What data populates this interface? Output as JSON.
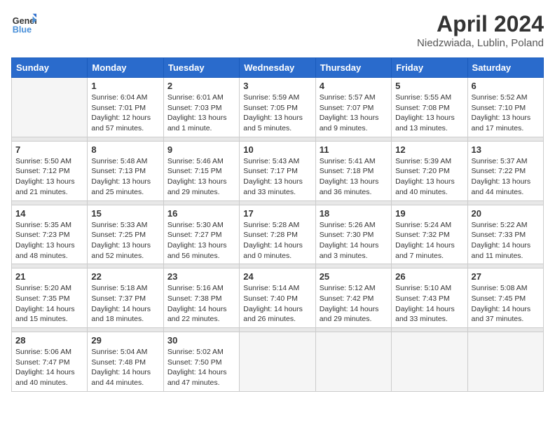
{
  "logo": {
    "line1": "General",
    "line2": "Blue"
  },
  "title": "April 2024",
  "subtitle": "Niedzwiada, Lublin, Poland",
  "days_header": [
    "Sunday",
    "Monday",
    "Tuesday",
    "Wednesday",
    "Thursday",
    "Friday",
    "Saturday"
  ],
  "weeks": [
    [
      {
        "day": "",
        "sunrise": "",
        "sunset": "",
        "daylight": ""
      },
      {
        "day": "1",
        "sunrise": "Sunrise: 6:04 AM",
        "sunset": "Sunset: 7:01 PM",
        "daylight": "Daylight: 12 hours and 57 minutes."
      },
      {
        "day": "2",
        "sunrise": "Sunrise: 6:01 AM",
        "sunset": "Sunset: 7:03 PM",
        "daylight": "Daylight: 13 hours and 1 minute."
      },
      {
        "day": "3",
        "sunrise": "Sunrise: 5:59 AM",
        "sunset": "Sunset: 7:05 PM",
        "daylight": "Daylight: 13 hours and 5 minutes."
      },
      {
        "day": "4",
        "sunrise": "Sunrise: 5:57 AM",
        "sunset": "Sunset: 7:07 PM",
        "daylight": "Daylight: 13 hours and 9 minutes."
      },
      {
        "day": "5",
        "sunrise": "Sunrise: 5:55 AM",
        "sunset": "Sunset: 7:08 PM",
        "daylight": "Daylight: 13 hours and 13 minutes."
      },
      {
        "day": "6",
        "sunrise": "Sunrise: 5:52 AM",
        "sunset": "Sunset: 7:10 PM",
        "daylight": "Daylight: 13 hours and 17 minutes."
      }
    ],
    [
      {
        "day": "7",
        "sunrise": "Sunrise: 5:50 AM",
        "sunset": "Sunset: 7:12 PM",
        "daylight": "Daylight: 13 hours and 21 minutes."
      },
      {
        "day": "8",
        "sunrise": "Sunrise: 5:48 AM",
        "sunset": "Sunset: 7:13 PM",
        "daylight": "Daylight: 13 hours and 25 minutes."
      },
      {
        "day": "9",
        "sunrise": "Sunrise: 5:46 AM",
        "sunset": "Sunset: 7:15 PM",
        "daylight": "Daylight: 13 hours and 29 minutes."
      },
      {
        "day": "10",
        "sunrise": "Sunrise: 5:43 AM",
        "sunset": "Sunset: 7:17 PM",
        "daylight": "Daylight: 13 hours and 33 minutes."
      },
      {
        "day": "11",
        "sunrise": "Sunrise: 5:41 AM",
        "sunset": "Sunset: 7:18 PM",
        "daylight": "Daylight: 13 hours and 36 minutes."
      },
      {
        "day": "12",
        "sunrise": "Sunrise: 5:39 AM",
        "sunset": "Sunset: 7:20 PM",
        "daylight": "Daylight: 13 hours and 40 minutes."
      },
      {
        "day": "13",
        "sunrise": "Sunrise: 5:37 AM",
        "sunset": "Sunset: 7:22 PM",
        "daylight": "Daylight: 13 hours and 44 minutes."
      }
    ],
    [
      {
        "day": "14",
        "sunrise": "Sunrise: 5:35 AM",
        "sunset": "Sunset: 7:23 PM",
        "daylight": "Daylight: 13 hours and 48 minutes."
      },
      {
        "day": "15",
        "sunrise": "Sunrise: 5:33 AM",
        "sunset": "Sunset: 7:25 PM",
        "daylight": "Daylight: 13 hours and 52 minutes."
      },
      {
        "day": "16",
        "sunrise": "Sunrise: 5:30 AM",
        "sunset": "Sunset: 7:27 PM",
        "daylight": "Daylight: 13 hours and 56 minutes."
      },
      {
        "day": "17",
        "sunrise": "Sunrise: 5:28 AM",
        "sunset": "Sunset: 7:28 PM",
        "daylight": "Daylight: 14 hours and 0 minutes."
      },
      {
        "day": "18",
        "sunrise": "Sunrise: 5:26 AM",
        "sunset": "Sunset: 7:30 PM",
        "daylight": "Daylight: 14 hours and 3 minutes."
      },
      {
        "day": "19",
        "sunrise": "Sunrise: 5:24 AM",
        "sunset": "Sunset: 7:32 PM",
        "daylight": "Daylight: 14 hours and 7 minutes."
      },
      {
        "day": "20",
        "sunrise": "Sunrise: 5:22 AM",
        "sunset": "Sunset: 7:33 PM",
        "daylight": "Daylight: 14 hours and 11 minutes."
      }
    ],
    [
      {
        "day": "21",
        "sunrise": "Sunrise: 5:20 AM",
        "sunset": "Sunset: 7:35 PM",
        "daylight": "Daylight: 14 hours and 15 minutes."
      },
      {
        "day": "22",
        "sunrise": "Sunrise: 5:18 AM",
        "sunset": "Sunset: 7:37 PM",
        "daylight": "Daylight: 14 hours and 18 minutes."
      },
      {
        "day": "23",
        "sunrise": "Sunrise: 5:16 AM",
        "sunset": "Sunset: 7:38 PM",
        "daylight": "Daylight: 14 hours and 22 minutes."
      },
      {
        "day": "24",
        "sunrise": "Sunrise: 5:14 AM",
        "sunset": "Sunset: 7:40 PM",
        "daylight": "Daylight: 14 hours and 26 minutes."
      },
      {
        "day": "25",
        "sunrise": "Sunrise: 5:12 AM",
        "sunset": "Sunset: 7:42 PM",
        "daylight": "Daylight: 14 hours and 29 minutes."
      },
      {
        "day": "26",
        "sunrise": "Sunrise: 5:10 AM",
        "sunset": "Sunset: 7:43 PM",
        "daylight": "Daylight: 14 hours and 33 minutes."
      },
      {
        "day": "27",
        "sunrise": "Sunrise: 5:08 AM",
        "sunset": "Sunset: 7:45 PM",
        "daylight": "Daylight: 14 hours and 37 minutes."
      }
    ],
    [
      {
        "day": "28",
        "sunrise": "Sunrise: 5:06 AM",
        "sunset": "Sunset: 7:47 PM",
        "daylight": "Daylight: 14 hours and 40 minutes."
      },
      {
        "day": "29",
        "sunrise": "Sunrise: 5:04 AM",
        "sunset": "Sunset: 7:48 PM",
        "daylight": "Daylight: 14 hours and 44 minutes."
      },
      {
        "day": "30",
        "sunrise": "Sunrise: 5:02 AM",
        "sunset": "Sunset: 7:50 PM",
        "daylight": "Daylight: 14 hours and 47 minutes."
      },
      {
        "day": "",
        "sunrise": "",
        "sunset": "",
        "daylight": ""
      },
      {
        "day": "",
        "sunrise": "",
        "sunset": "",
        "daylight": ""
      },
      {
        "day": "",
        "sunrise": "",
        "sunset": "",
        "daylight": ""
      },
      {
        "day": "",
        "sunrise": "",
        "sunset": "",
        "daylight": ""
      }
    ]
  ]
}
